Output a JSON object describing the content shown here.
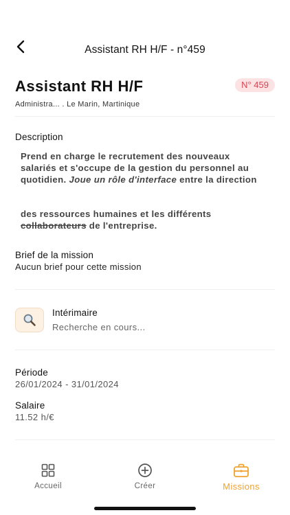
{
  "header": {
    "title": "Assistant RH H/F - n°459"
  },
  "mission": {
    "title": "Assistant RH H/F",
    "badge": "N° 459",
    "category": "Administra...",
    "separator": ".",
    "location": "Le Marin, Martinique"
  },
  "description": {
    "label": "Description",
    "p1_a": "Prend en charge le recrutement des nouveaux salariés et s'occupe de la gestion du personnel au quotidien. ",
    "p1_em": "Joue un rôle d'interface",
    "p1_b": " entre la direction",
    "p2_a": "des ressources humaines et les différents ",
    "p2_strike": "collaborateurs",
    "p2_b": " de l'entreprise."
  },
  "brief": {
    "label": "Brief de la mission",
    "value": "Aucun brief pour cette mission"
  },
  "interimaire": {
    "label": "Intérimaire",
    "status": "Recherche en cours...",
    "icon": "search-icon"
  },
  "periode": {
    "label": "Période",
    "value": "26/01/2024 - 31/01/2024"
  },
  "salaire": {
    "label": "Salaire",
    "value": "11.52 h/€"
  },
  "tabs": {
    "home": {
      "label": "Accueil",
      "icon": "grid-icon"
    },
    "create": {
      "label": "Créer",
      "icon": "plus-circle-icon"
    },
    "missions": {
      "label": "Missions",
      "icon": "briefcase-icon"
    }
  },
  "colors": {
    "accent": "#f0a22e",
    "badge_bg": "#fde2e4",
    "badge_text": "#d64553"
  }
}
